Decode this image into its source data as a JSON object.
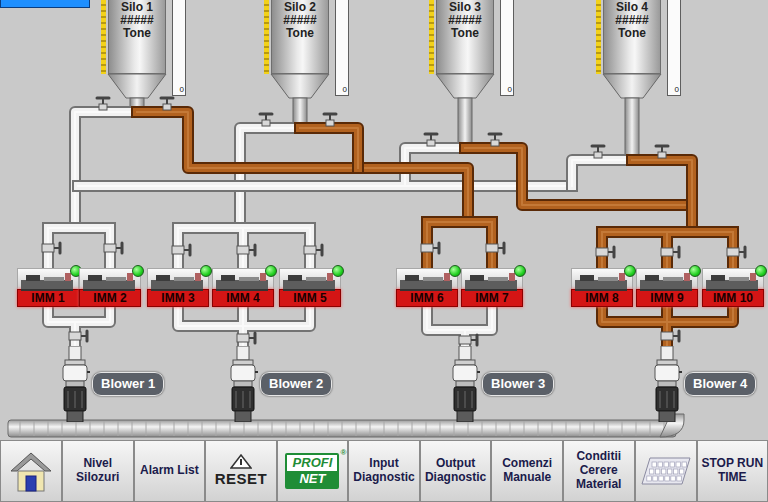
{
  "silos": [
    {
      "name": "Silo 1",
      "reading": "#####",
      "unit": "Tone",
      "scale_min": "0"
    },
    {
      "name": "Silo 2",
      "reading": "#####",
      "unit": "Tone",
      "scale_min": "0"
    },
    {
      "name": "Silo 3",
      "reading": "#####",
      "unit": "Tone",
      "scale_min": "0"
    },
    {
      "name": "Silo 4",
      "reading": "#####",
      "unit": "Tone",
      "scale_min": "0"
    }
  ],
  "pipes": [
    {
      "active": false
    },
    {
      "active": true
    },
    {
      "active": false
    },
    {
      "active": true
    },
    {
      "active": false
    },
    {
      "active": true
    },
    {
      "active": false
    },
    {
      "active": true
    },
    {
      "active": false
    },
    {
      "active": false
    },
    {
      "active": true
    },
    {
      "active": false
    },
    {
      "active": true
    },
    {
      "active": true
    }
  ],
  "machines": [
    {
      "label": "IMM 1",
      "on": true
    },
    {
      "label": "IMM 2",
      "on": true
    },
    {
      "label": "IMM 3",
      "on": true
    },
    {
      "label": "IMM 4",
      "on": true
    },
    {
      "label": "IMM 5",
      "on": true
    },
    {
      "label": "IMM 6",
      "on": true
    },
    {
      "label": "IMM 7",
      "on": true
    },
    {
      "label": "IMM 8",
      "on": true
    },
    {
      "label": "IMM 9",
      "on": true
    },
    {
      "label": "IMM 10",
      "on": true
    }
  ],
  "blowers": [
    {
      "label": "Blower 1"
    },
    {
      "label": "Blower 2"
    },
    {
      "label": "Blower 3"
    },
    {
      "label": "Blower 4"
    }
  ],
  "toolbar": [
    {
      "kind": "home"
    },
    {
      "kind": "text",
      "label": "Nivel Silozuri"
    },
    {
      "kind": "text",
      "label": "Alarm List"
    },
    {
      "kind": "reset",
      "label": "RESET"
    },
    {
      "kind": "profinet",
      "lines": [
        "PROFI",
        "NET"
      ],
      "mark": "®"
    },
    {
      "kind": "text",
      "label": "Input Diagnostic"
    },
    {
      "kind": "text",
      "label": "Output Diagnostic"
    },
    {
      "kind": "text",
      "label": "Comenzi Manuale"
    },
    {
      "kind": "text",
      "label": "Conditii Cerere Material"
    },
    {
      "kind": "keyboard"
    },
    {
      "kind": "text",
      "label": "STOP RUN TIME"
    }
  ]
}
